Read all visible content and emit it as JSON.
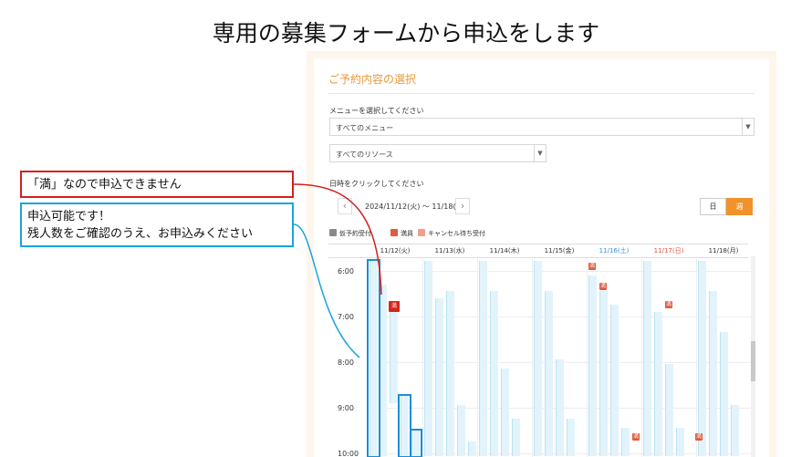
{
  "slide": {
    "title": "専用の募集フォームから申込をします"
  },
  "form": {
    "section_title": "ご予約内容の選択",
    "menu_label": "メニューを選択してください",
    "menu_value": "すべてのメニュー",
    "resource_value": "すべてのリソース",
    "date_label": "日時をクリックしてください",
    "date_range": "2024/11/12(火) 〜 11/18(月)",
    "prev_icon": "chevron-left-icon",
    "next_icon": "chevron-right-icon",
    "toggle_day": "日",
    "toggle_week": "週",
    "legend": [
      {
        "label": "仮予約受付",
        "color": "#8a8a8a"
      },
      {
        "label": "満員",
        "color": "#e05b3f"
      },
      {
        "label": "キャンセル待ち受付",
        "color": "#f0a08a"
      }
    ],
    "days": [
      {
        "label": "11/12(火)",
        "color": "#333333"
      },
      {
        "label": "11/13(水)",
        "color": "#333333"
      },
      {
        "label": "11/14(木)",
        "color": "#333333"
      },
      {
        "label": "11/15(金)",
        "color": "#333333"
      },
      {
        "label": "11/16(土)",
        "color": "#3a8fd6"
      },
      {
        "label": "11/17(日)",
        "color": "#e0533a"
      },
      {
        "label": "11/18(月)",
        "color": "#333333"
      }
    ],
    "times": [
      "6:00",
      "7:00",
      "8:00",
      "9:00",
      "10:00"
    ],
    "full_mark": "満"
  },
  "callouts": {
    "red": "「満」なので申込できません",
    "blue_line1": "申込可能です！",
    "blue_line2": "残人数をご確認のうえ、お申込みください"
  }
}
